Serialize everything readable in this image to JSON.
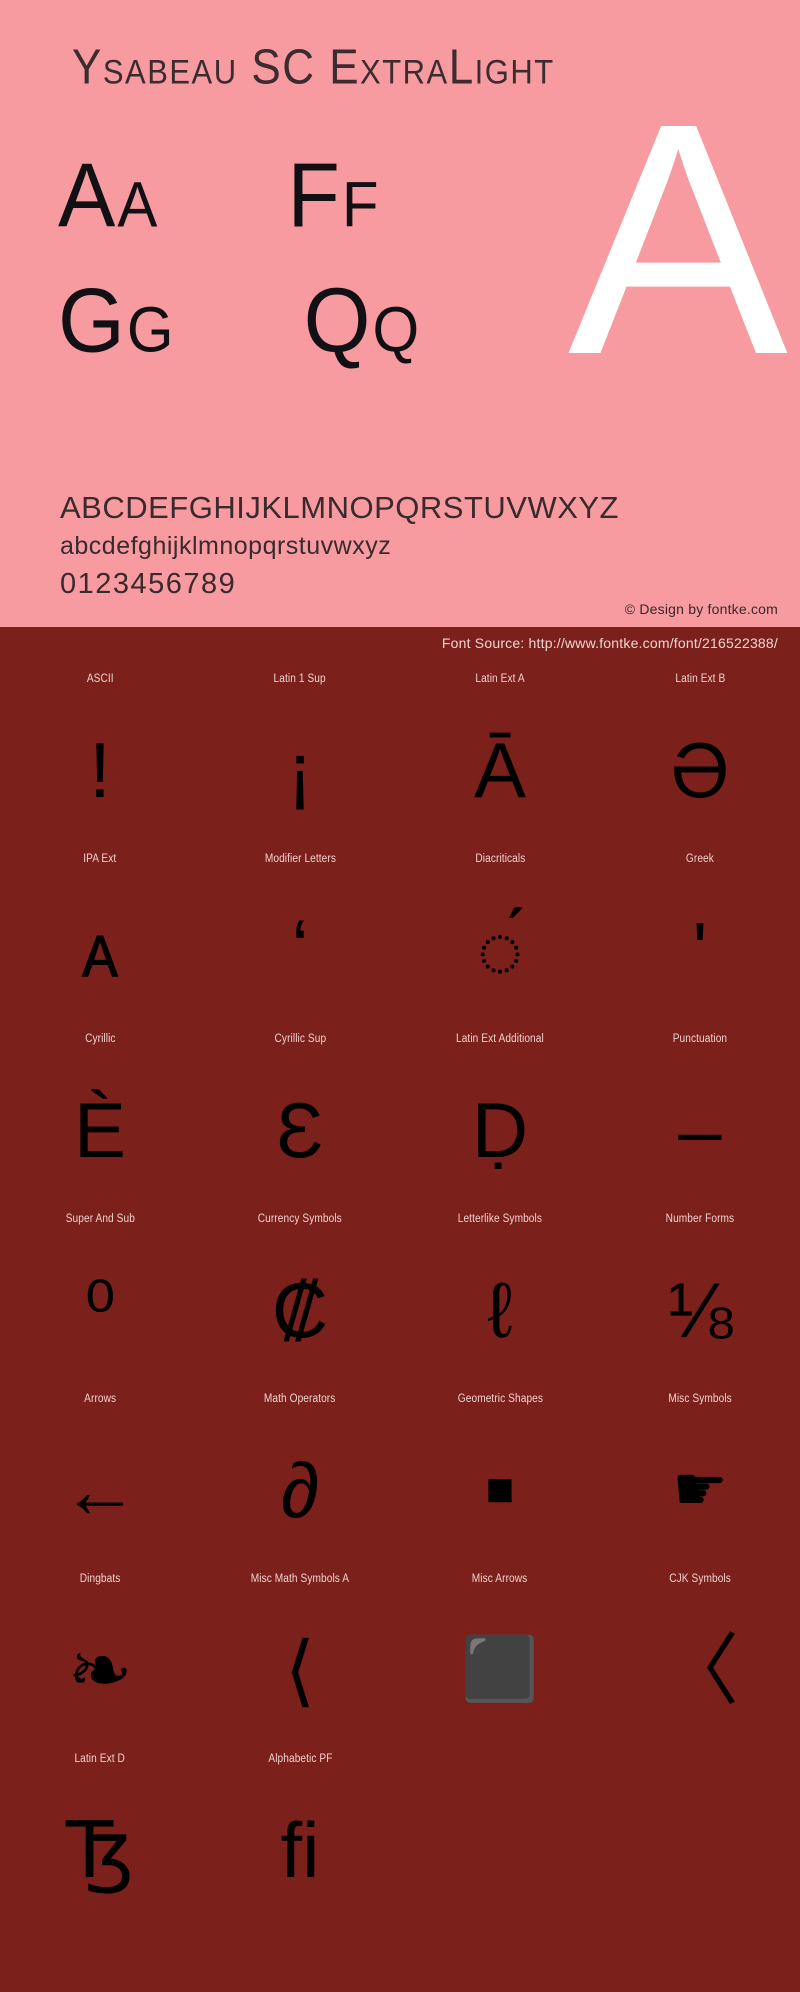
{
  "colors": {
    "top_background": "#f79ba0",
    "bottom_background": "#7c201c",
    "glyph_black": "#000000",
    "watermark_white": "#ffffff",
    "label_text": "#efd2ce"
  },
  "header": {
    "font_title": "Ysabeau SC ExtraLight"
  },
  "top_panel": {
    "watermark_letter": "A",
    "glyph_pairs": [
      {
        "name": "a-pair",
        "text": "Aa"
      },
      {
        "name": "f-pair",
        "text": "Ff"
      },
      {
        "name": "g-pair",
        "text": "Gg"
      },
      {
        "name": "q-pair",
        "text": "Qq"
      }
    ],
    "alphabet_uppercase": "ABCDEFGHIJKLMNOPQRSTUVWXYZ",
    "alphabet_lowercase": "abcdefghijklmnopqrstuvwxyz",
    "digits": "0123456789",
    "copyright": "© Design by fontke.com"
  },
  "bottom_panel": {
    "source": "Font Source: http://www.fontke.com/font/216522388/",
    "unicode_blocks": [
      {
        "label": "ASCII",
        "glyph": "!",
        "size": "normal"
      },
      {
        "label": "Latin 1 Sup",
        "glyph": "¡",
        "size": "normal"
      },
      {
        "label": "Latin Ext A",
        "glyph": "Ā",
        "size": "normal"
      },
      {
        "label": "Latin Ext B",
        "glyph": "Ə",
        "size": "normal"
      },
      {
        "label": "IPA Ext",
        "glyph": "ᴀ",
        "size": "normal"
      },
      {
        "label": "Modifier Letters",
        "glyph": "ʻ",
        "size": "normal"
      },
      {
        "label": "Diacriticals",
        "glyph": "◌́",
        "size": "normal"
      },
      {
        "label": "Greek",
        "glyph": "ʹ",
        "size": "normal"
      },
      {
        "label": "Cyrillic",
        "glyph": "Ѐ",
        "size": "normal"
      },
      {
        "label": "Cyrillic Sup",
        "glyph": "Ɛ",
        "size": "normal"
      },
      {
        "label": "Latin Ext Additional",
        "glyph": "Ḍ",
        "size": "normal"
      },
      {
        "label": "Punctuation",
        "glyph": "‒",
        "size": "normal"
      },
      {
        "label": "Super And Sub",
        "glyph": "⁰",
        "size": "normal"
      },
      {
        "label": "Currency Symbols",
        "glyph": "₡",
        "size": "normal"
      },
      {
        "label": "Letterlike Symbols",
        "glyph": "ℓ",
        "size": "normal"
      },
      {
        "label": "Number Forms",
        "glyph": "⅛",
        "size": "normal"
      },
      {
        "label": "Arrows",
        "glyph": "←",
        "size": "normal"
      },
      {
        "label": "Math Operators",
        "glyph": "∂",
        "size": "normal"
      },
      {
        "label": "Geometric Shapes",
        "glyph": "■",
        "size": "tiny"
      },
      {
        "label": "Misc Symbols",
        "glyph": "☛",
        "size": "small"
      },
      {
        "label": "Dingbats",
        "glyph": "❧",
        "size": "normal"
      },
      {
        "label": "Misc Math Symbols A",
        "glyph": "⟨",
        "size": "normal"
      },
      {
        "label": "Misc Arrows",
        "glyph": "⬛",
        "size": "small"
      },
      {
        "label": "CJK Symbols",
        "glyph": "〈",
        "size": "normal"
      },
      {
        "label": "Latin Ext D",
        "glyph": "Ꜩ",
        "size": "normal"
      },
      {
        "label": "Alphabetic PF",
        "glyph": "ﬁ",
        "size": "normal"
      }
    ]
  }
}
